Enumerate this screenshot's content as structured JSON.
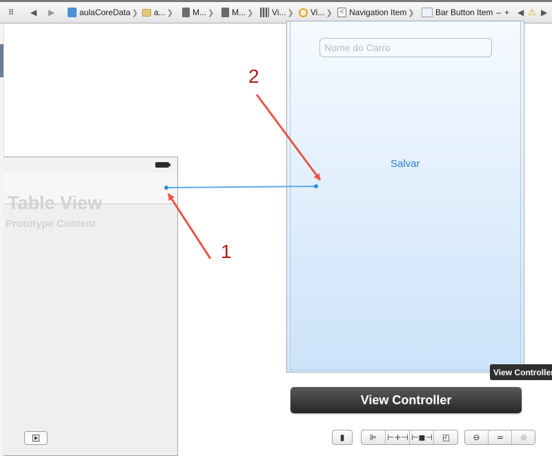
{
  "jump_bar": {
    "items": [
      {
        "label": "aulaCoreData",
        "icon": "project-icon"
      },
      {
        "label": "a...",
        "icon": "folder-icon"
      },
      {
        "label": "M...",
        "icon": "file-icon"
      },
      {
        "label": "M...",
        "icon": "file-icon"
      },
      {
        "label": "Vi...",
        "icon": "storyboard-icon"
      },
      {
        "label": "Vi...",
        "icon": "view-controller-icon"
      },
      {
        "label": "Navigation Item",
        "icon": "navigation-item-icon"
      },
      {
        "label": "Bar Button Item",
        "icon": "bar-button-item-icon"
      }
    ],
    "minus": "–",
    "plus": "+"
  },
  "table_view_scene": {
    "title": "Table View",
    "subtitle": "Prototype Content"
  },
  "view_controller_scene": {
    "text_field_placeholder": "Nome do Carro",
    "button_label": "Salvar",
    "scene_label": "View Controller",
    "tooltip": "View Controller"
  },
  "annotations": {
    "arrow1_label": "1",
    "arrow2_label": "2",
    "arrow_color": "#e8554a",
    "label_color": "#b01818",
    "connection_color": "#5aa9e6"
  },
  "bottom_toolbar": {
    "icons": [
      "resize-icon",
      "align-icon",
      "pin-icon",
      "resolve-icon",
      "embed-icon",
      "zoom-out-icon",
      "actual-size-icon",
      "zoom-in-icon"
    ]
  }
}
